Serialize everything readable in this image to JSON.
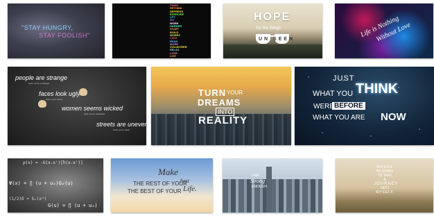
{
  "gallery": {
    "t1": {
      "line1": "\"STAY HUNGRY,",
      "line2": "STAY FOOLISH\""
    },
    "t2": {
      "words": [
        "THINK",
        "RETHINK",
        "DEPRESS",
        "EXERCISE",
        "LET",
        "GO",
        "WORK",
        "HARDER",
        "START",
        "BUILD",
        "WORRY",
        "LESS",
        "READ",
        "MORE",
        "VOLUNTEER",
        "RELAX",
        "LOVE",
        "LIVE"
      ]
    },
    "t3": {
      "hope": "HOPE",
      "small": "for the things",
      "unseen": "UN SEEN"
    },
    "t4": {
      "line1": "Life is Nothing",
      "line2": "Without Love"
    },
    "t5": {
      "l1": "people are strange",
      "s1": "when you're a stranger",
      "l2": "faces look ugly",
      "s2": "when you're alone",
      "l3": "women seems wicked",
      "s3": "when you're unwanted",
      "l4": "streets are uneven",
      "s4": "when you're down"
    },
    "t6": {
      "turn": "TURN",
      "your": "YOUR",
      "dreams": "DREAMS",
      "into": "INTO",
      "reality": "REALITY"
    },
    "t7": {
      "just": "JUST",
      "what_you": "WHAT YOU",
      "think": "THINK",
      "were": "WERE",
      "before": "BEFORE",
      "what_now": "WHAT YOU ARE",
      "now": "NOW"
    },
    "t8": {
      "formula1": "ρ(x) = -G(x-x')[ħ(x-x')]",
      "formula2": "Ψ(x) = ∏ (u + uₓ)Gₓ(u)",
      "formula3": "(1/2)δ = Sₓ(x⁴)",
      "formula4": "G(u) = ∏ (u + uₓ)"
    },
    "t9": {
      "make": "Make",
      "the_rest": "THE REST OF YOUR",
      "best": "best",
      "the_best": "THE BEST OF YOUR",
      "life": "Life."
    },
    "t10": {
      "line1": "I AM",
      "line2": "Strong",
      "line3": "ENOUGH"
    },
    "t11": {
      "l1": "WHERE",
      "l2": "I'M GOING",
      "l3": "TO TAKE",
      "l4": "A",
      "l5": "JOURNEY",
      "l6": "INTO",
      "l7": "MYSELF"
    }
  },
  "colors": {
    "t2_words": [
      "#ff5aa5",
      "#ff9a3c",
      "#ffe14d",
      "#7dff6a",
      "#32d4ff",
      "#9a7dff",
      "#ffffff",
      "#4dffc4",
      "#ffa64d",
      "#ffd54d",
      "#c0ff4d",
      "#ff4d6d",
      "#4dc9ff",
      "#c98bff",
      "#ffee58",
      "#80deea",
      "#ff80ab",
      "#ffab40"
    ]
  }
}
